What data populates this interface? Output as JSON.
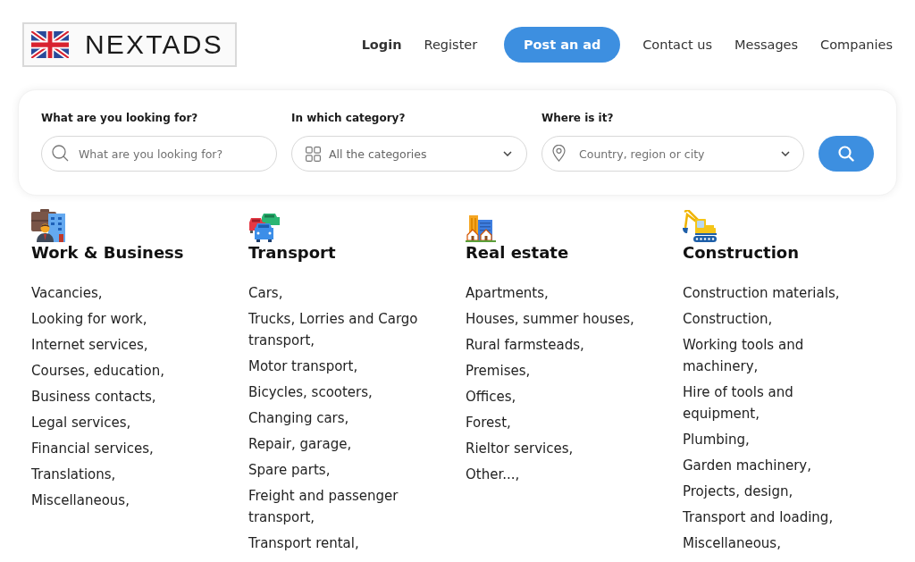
{
  "header": {
    "logo": {
      "text": "NEXTADS"
    },
    "nav": [
      {
        "label": "Login",
        "kind": "strong"
      },
      {
        "label": "Register",
        "kind": "link"
      },
      {
        "label": "Post an ad",
        "kind": "button"
      },
      {
        "label": "Contact us",
        "kind": "link"
      },
      {
        "label": "Messages",
        "kind": "link"
      },
      {
        "label": "Companies",
        "kind": "link"
      }
    ]
  },
  "search": {
    "fields": [
      {
        "kind": "text",
        "label": "What are you looking for?",
        "placeholder": "What are you looking for?"
      },
      {
        "kind": "select",
        "label": "In which category?",
        "value": "All the categories"
      },
      {
        "kind": "location",
        "label": "Where is it?",
        "placeholder": "Country, region or city"
      }
    ]
  },
  "categories": [
    {
      "kind": "work",
      "title": "Work & Business",
      "items": [
        "Vacancies,",
        "Looking for work,",
        "Internet services,",
        "Courses, education,",
        "Business contacts,",
        "Legal services,",
        "Financial services,",
        "Translations,",
        "Miscellaneous,"
      ]
    },
    {
      "kind": "transport",
      "title": "Transport",
      "items": [
        "Cars,",
        "Trucks, Lorries and Cargo transport,",
        "Motor transport,",
        "Bicycles, scooters,",
        "Changing cars,",
        "Repair, garage,",
        "Spare parts,",
        "Freight and passenger transport,",
        "Transport rental,"
      ]
    },
    {
      "kind": "real_estate",
      "title": "Real estate",
      "items": [
        "Apartments,",
        "Houses, summer houses,",
        "Rural farmsteads,",
        "Premises,",
        "Offices,",
        "Forest,",
        "Rieltor services,",
        "Other...,"
      ]
    },
    {
      "kind": "construction",
      "title": "Construction",
      "items": [
        "Construction materials,",
        "Construction,",
        "Working tools and machinery,",
        "Hire of tools and equipment,",
        "Plumbing,",
        "Garden machinery,",
        "Projects, design,",
        "Transport and loading,",
        "Miscellaneous,"
      ]
    }
  ]
}
